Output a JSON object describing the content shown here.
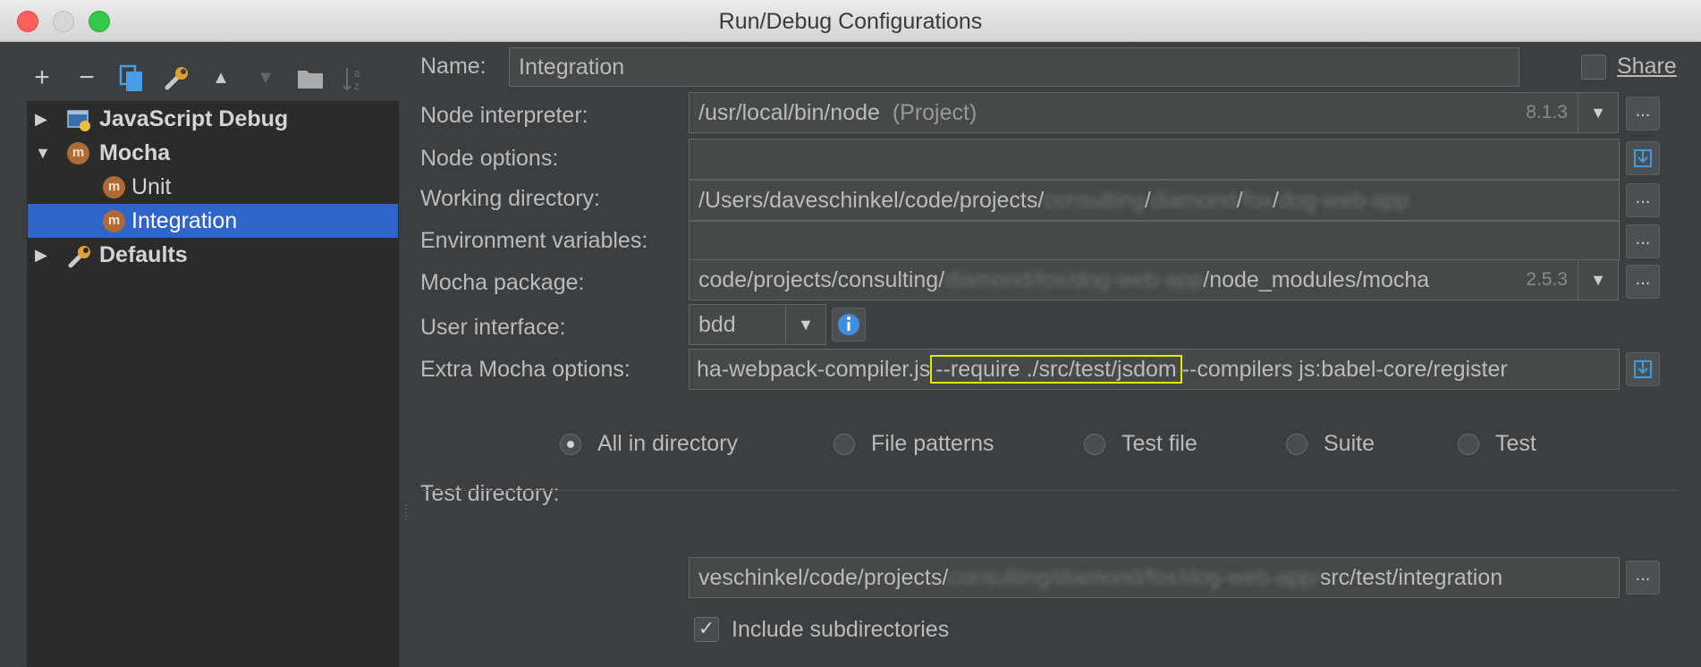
{
  "window": {
    "title": "Run/Debug Configurations"
  },
  "toolbar": {
    "add": "+",
    "remove": "−",
    "move_up": "▲",
    "move_down": "▼"
  },
  "tree": {
    "items": [
      {
        "label": "JavaScript Debug",
        "icon": "javascript-debug-icon"
      },
      {
        "label": "Mocha",
        "icon": "mocha-icon"
      },
      {
        "label": "Unit",
        "icon": "mocha-icon"
      },
      {
        "label": "Integration",
        "icon": "mocha-icon",
        "selected": true
      },
      {
        "label": "Defaults",
        "icon": "wrench-icon"
      }
    ],
    "mocha_letter": "m"
  },
  "form": {
    "name_label": "Name:",
    "name_value": "Integration",
    "share_label": "Share",
    "node_interpreter_label": "Node interpreter:",
    "node_interpreter_value": "/usr/local/bin/node",
    "node_interpreter_tag": "(Project)",
    "node_version": "8.1.3",
    "node_options_label": "Node options:",
    "node_options_value": "",
    "working_dir_label": "Working directory:",
    "working_dir_prefix": "/Users/daveschinkel/code/projects/",
    "working_dir_blur1": "consulting",
    "working_dir_blur2": "diamond",
    "working_dir_blur3": "fox",
    "working_dir_blur4": "dog-web-app",
    "env_label": "Environment variables:",
    "env_value": "",
    "mocha_pkg_label": "Mocha package:",
    "mocha_pkg_prefix": "code/projects/consulting/",
    "mocha_pkg_blur": "diamond/fox/dog-web-app",
    "mocha_pkg_suffix": "/node_modules/mocha",
    "mocha_version": "2.5.3",
    "ui_label": "User interface:",
    "ui_value": "bdd",
    "extra_label": "Extra Mocha options:",
    "extra_part1": "ha-webpack-compiler.js",
    "extra_highlight": "--require ./src/test/jsdom",
    "extra_part2": "--compilers js:babel-core/register",
    "ellipsis": "..."
  },
  "test_kind": {
    "options": [
      {
        "label": "All in directory",
        "selected": true
      },
      {
        "label": "File patterns",
        "selected": false
      },
      {
        "label": "Test file",
        "selected": false
      },
      {
        "label": "Suite",
        "selected": false
      },
      {
        "label": "Test",
        "selected": false
      }
    ]
  },
  "test_dir": {
    "label": "Test directory:",
    "prefix": "veschinkel/code/projects/",
    "blur": "consulting/diamond/fox/dog-web-app/",
    "suffix": "src/test/integration",
    "include_sub_label": "Include subdirectories",
    "include_sub_checked": true
  },
  "colors": {
    "selection": "#2f65ca",
    "highlight_box": "#e6e600"
  }
}
